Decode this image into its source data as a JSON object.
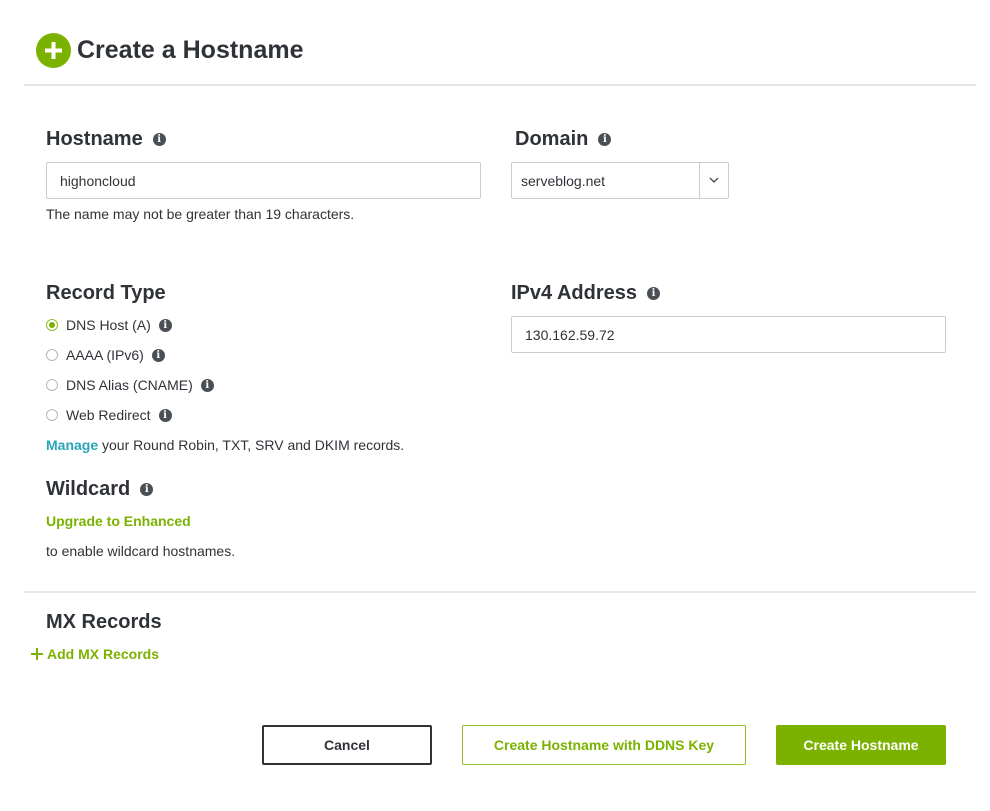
{
  "header": {
    "title": "Create a Hostname",
    "icon": "plus-circle-icon"
  },
  "hostname": {
    "label": "Hostname",
    "value": "highoncloud",
    "helper": "The name may not be greater than 19 characters."
  },
  "domain": {
    "label": "Domain",
    "value": "serveblog.net"
  },
  "record_type": {
    "label": "Record Type",
    "options": [
      {
        "label": "DNS Host (A)",
        "checked": true
      },
      {
        "label": "AAAA (IPv6)",
        "checked": false
      },
      {
        "label": "DNS Alias (CNAME)",
        "checked": false
      },
      {
        "label": "Web Redirect",
        "checked": false
      }
    ],
    "manage_link": "Manage",
    "manage_text": " your Round Robin, TXT, SRV and DKIM records."
  },
  "ipv4": {
    "label": "IPv4 Address",
    "value": "130.162.59.72"
  },
  "wildcard": {
    "label": "Wildcard",
    "upgrade_link": "Upgrade to Enhanced",
    "text": "to enable wildcard hostnames."
  },
  "mx": {
    "label": "MX Records",
    "add_link": "Add MX Records"
  },
  "buttons": {
    "cancel": "Cancel",
    "ddns": "Create Hostname with DDNS Key",
    "create": "Create Hostname"
  },
  "colors": {
    "accent": "#7bb200",
    "link": "#2aa5b8",
    "text": "#2f3338"
  }
}
